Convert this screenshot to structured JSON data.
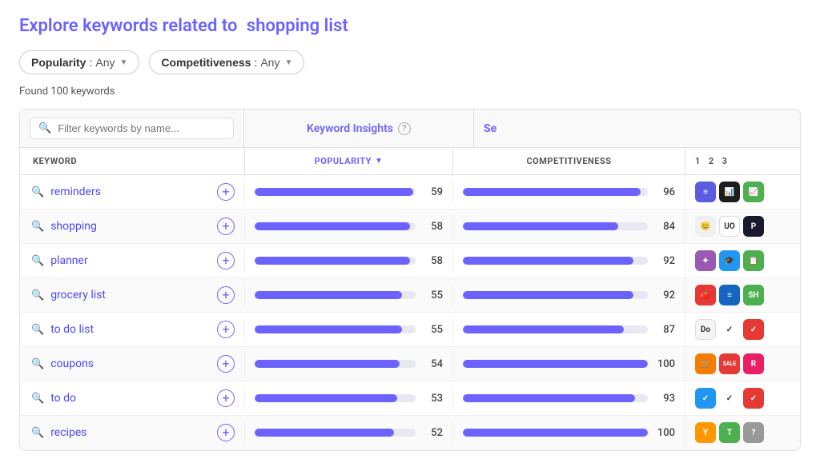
{
  "title": {
    "prefix": "Explore keywords related to",
    "keyword": "shopping list"
  },
  "filters": {
    "popularity": {
      "label": "Popularity",
      "value": "Any"
    },
    "competitiveness": {
      "label": "Competitiveness",
      "value": "Any"
    }
  },
  "found_text": "Found 100 keywords",
  "search_placeholder": "Filter keywords by name...",
  "columns": {
    "keyword": "KEYWORD",
    "popularity": "POPULARITY",
    "competitiveness": "COMPETITIVENESS",
    "se_nums": [
      "1",
      "2",
      "3"
    ]
  },
  "insights_label": "Keyword Insights",
  "se_label": "Se",
  "keywords": [
    {
      "text": "reminders",
      "popularity": 59,
      "competitiveness": 96
    },
    {
      "text": "shopping",
      "popularity": 58,
      "competitiveness": 84
    },
    {
      "text": "planner",
      "popularity": 58,
      "competitiveness": 92
    },
    {
      "text": "grocery list",
      "popularity": 55,
      "competitiveness": 92
    },
    {
      "text": "to do list",
      "popularity": 55,
      "competitiveness": 87
    },
    {
      "text": "coupons",
      "popularity": 54,
      "competitiveness": 100
    },
    {
      "text": "to do",
      "popularity": 53,
      "competitiveness": 93
    },
    {
      "text": "recipes",
      "popularity": 52,
      "competitiveness": 100
    }
  ],
  "app_icons": [
    [
      {
        "bg": "#5c5ce0",
        "text": "≡",
        "color": "#fff"
      },
      {
        "bg": "#1e1e1e",
        "text": "📊",
        "color": "#fff"
      },
      {
        "bg": "#4caf50",
        "text": "📈",
        "color": "#fff"
      }
    ],
    [
      {
        "bg": "#f0f0f0",
        "text": "😊",
        "color": "#333"
      },
      {
        "bg": "#fff",
        "text": "UO",
        "color": "#333",
        "border": "1px solid #ddd"
      },
      {
        "bg": "#1a1a2e",
        "text": "P",
        "color": "#fff"
      }
    ],
    [
      {
        "bg": "#9b59b6",
        "text": "✦",
        "color": "#fff"
      },
      {
        "bg": "#2196f3",
        "text": "🎓",
        "color": "#fff"
      },
      {
        "bg": "#4caf50",
        "text": "📋",
        "color": "#fff"
      }
    ],
    [
      {
        "bg": "#e53935",
        "text": "🍅",
        "color": "#fff"
      },
      {
        "bg": "#1565c0",
        "text": "≡",
        "color": "#fff"
      },
      {
        "bg": "#4caf50",
        "text": "SH",
        "color": "#fff"
      }
    ],
    [
      {
        "bg": "#f5f5f5",
        "text": "Do",
        "color": "#333",
        "border": "1px solid #ddd"
      },
      {
        "bg": "#fff",
        "text": "✓",
        "color": "#333"
      },
      {
        "bg": "#e53935",
        "text": "✓",
        "color": "#fff"
      }
    ],
    [
      {
        "bg": "#f57c00",
        "text": "🛒",
        "color": "#fff"
      },
      {
        "bg": "#e53935",
        "text": "SALE",
        "color": "#fff",
        "fontSize": "7px"
      },
      {
        "bg": "#e91e63",
        "text": "R",
        "color": "#fff",
        "italic": true
      }
    ],
    [
      {
        "bg": "#2196f3",
        "text": "✓",
        "color": "#fff"
      },
      {
        "bg": "#fff",
        "text": "✓",
        "color": "#333"
      },
      {
        "bg": "#e53935",
        "text": "✓",
        "color": "#fff"
      }
    ],
    [
      {
        "bg": "#ff9800",
        "text": "Y",
        "color": "#fff"
      },
      {
        "bg": "#4caf50",
        "text": "T",
        "color": "#fff"
      },
      {
        "bg": "#999",
        "text": "?",
        "color": "#fff"
      }
    ]
  ]
}
